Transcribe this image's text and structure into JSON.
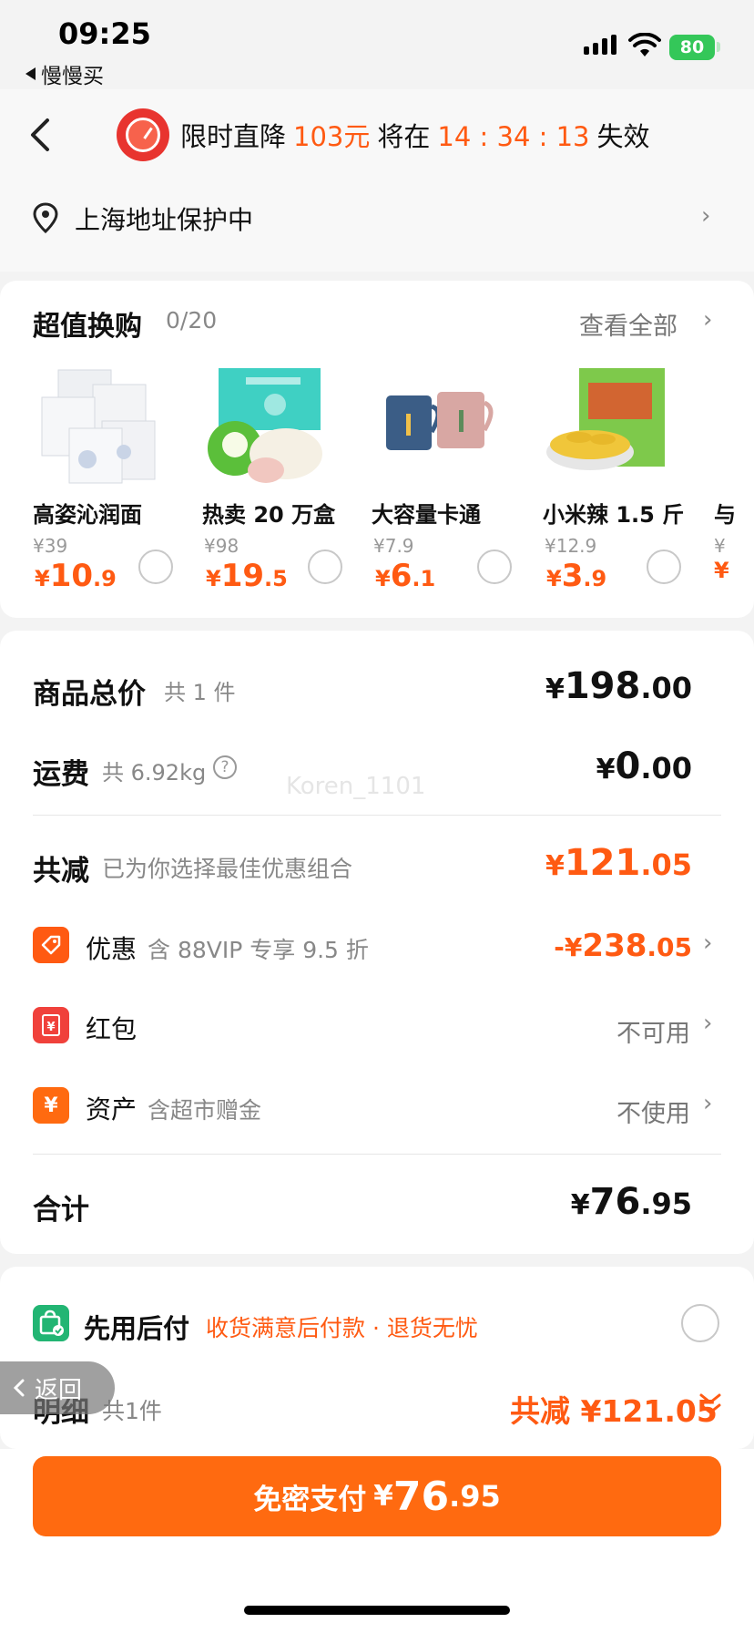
{
  "status_bar": {
    "time": "09:25",
    "back_app": "慢慢买",
    "battery": "80"
  },
  "header": {
    "promo_prefix": "限时直降",
    "promo_amount": "103元",
    "promo_mid": "将在",
    "countdown": "14 : 34 : 13",
    "promo_suffix": "失效"
  },
  "address": {
    "text": "上海地址保护中"
  },
  "swap": {
    "title": "超值换购",
    "count": "0/20",
    "view_all": "查看全部",
    "products": [
      {
        "name": "高姿沁润面",
        "orig": "¥39",
        "yen": "¥",
        "price_int": "10",
        "price_dec": ".9"
      },
      {
        "name": "热卖 20 万盒",
        "orig": "¥98",
        "yen": "¥",
        "price_int": "19",
        "price_dec": ".5"
      },
      {
        "name": "大容量卡通",
        "orig": "¥7.9",
        "yen": "¥",
        "price_int": "6",
        "price_dec": ".1"
      },
      {
        "name": "小米辣 1.5 斤",
        "orig": "¥12.9",
        "yen": "¥",
        "price_int": "3",
        "price_dec": ".9"
      },
      {
        "name": "与",
        "orig": "¥",
        "yen": "¥",
        "price_int": "",
        "price_dec": ""
      }
    ]
  },
  "summary": {
    "goods_label": "商品总价",
    "goods_count": "共 1 件",
    "goods_yen": "¥",
    "goods_int": "198",
    "goods_dec": ".00",
    "shipping_label": "运费",
    "shipping_weight": "共 6.92kg",
    "shipping_help": "?",
    "shipping_yen": "¥",
    "shipping_int": "0",
    "shipping_dec": ".00",
    "reduce_label": "共减",
    "reduce_sub": "已为你选择最佳优惠组合",
    "reduce_yen": "¥",
    "reduce_int": "121",
    "reduce_dec": ".05",
    "discount_label": "优惠",
    "discount_sub": "含 88VIP 专享 9.5 折",
    "discount_amount_prefix": "-¥",
    "discount_int": "238",
    "discount_dec": ".05",
    "redpack_label": "红包",
    "redpack_value": "不可用",
    "asset_label": "资产",
    "asset_sub": "含超市赠金",
    "asset_value": "不使用",
    "total_label": "合计",
    "total_yen": "¥",
    "total_int": "76",
    "total_dec": ".95"
  },
  "pay_later": {
    "label": "先用后付",
    "desc": "收货满意后付款 · 退货无忧"
  },
  "detail": {
    "label": "明细",
    "count": "共1件",
    "total": "共减 ¥121.05"
  },
  "float_back": "返回",
  "pay_button": {
    "label": "免密支付",
    "yen": "¥",
    "int": "76",
    "dec": ".95"
  },
  "watermark": "Koren_1101",
  "colors": {
    "accent": "#ff5a12",
    "button": "#ff6a10",
    "pay_later_green": "#22b573"
  }
}
